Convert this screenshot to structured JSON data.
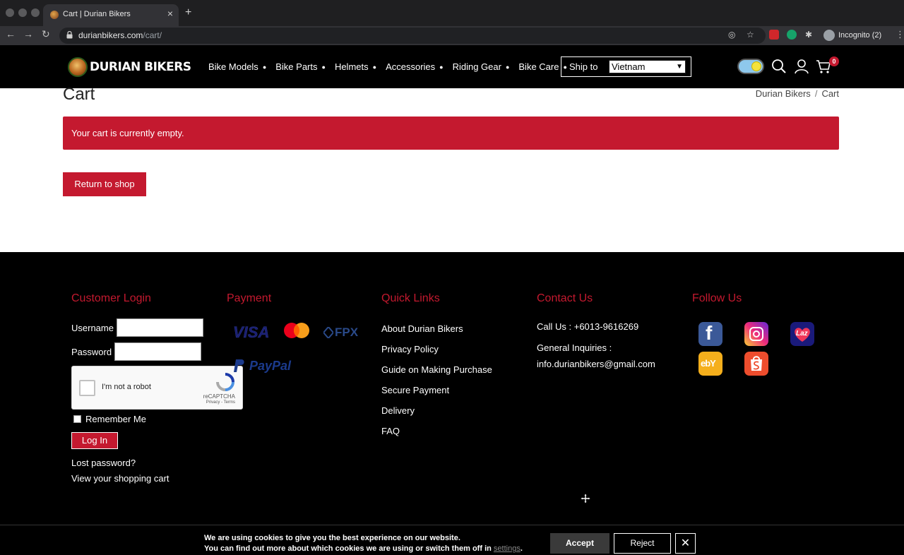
{
  "browser": {
    "tab_title": "Cart | Durian Bikers",
    "url_host": "durianbikers.com",
    "url_path": "/cart/",
    "profile_label": "Incognito (2)"
  },
  "header": {
    "logo_text": "DURIAN BIKERS",
    "menu": [
      {
        "label": "Bike Models"
      },
      {
        "label": "Bike Parts"
      },
      {
        "label": "Helmets"
      },
      {
        "label": "Accessories"
      },
      {
        "label": "Riding Gear"
      },
      {
        "label": "Bike Care"
      }
    ],
    "ship_to_label": "Ship to",
    "ship_to_value": "Vietnam",
    "cart_count": "0"
  },
  "main": {
    "title": "Cart",
    "breadcrumb": [
      "Durian Bikers",
      "Cart"
    ],
    "notice": "Your cart is currently empty.",
    "return_button": "Return to shop"
  },
  "footer": {
    "login": {
      "title": "Customer Login",
      "username_label": "Username",
      "password_label": "Password",
      "recaptcha_label": "I'm not a robot",
      "recaptcha_brand": "reCAPTCHA",
      "recaptcha_terms": "Privacy - Terms",
      "remember_label": "Remember Me",
      "login_button": "Log In",
      "lost_password": "Lost password?",
      "view_cart": "View your shopping cart"
    },
    "payment": {
      "title": "Payment",
      "logos": [
        "VISA",
        "FPX",
        "PayPal"
      ]
    },
    "quick_links": {
      "title": "Quick Links",
      "links": [
        "About Durian Bikers",
        "Privacy Policy",
        "Guide on Making Purchase",
        "Secure Payment",
        "Delivery",
        "FAQ"
      ]
    },
    "contact": {
      "title": "Contact Us",
      "phone": "Call Us : +6013-9616269",
      "inquiries_label": "General Inquiries :",
      "email": "info.durianbikers@gmail.com"
    },
    "follow": {
      "title": "Follow Us",
      "lazada_text": "Laz",
      "ebay_text": "ebY"
    }
  },
  "cookie": {
    "line1": "We are using cookies to give you the best experience on our website.",
    "line2": "You can find out more about which cookies we are using or switch them off in",
    "settings_link": "settings",
    "line2_end": ".",
    "accept": "Accept",
    "reject": "Reject",
    "close": "✕"
  },
  "colors": {
    "brand_red": "#c4192f",
    "footer_bg": "#000000"
  }
}
